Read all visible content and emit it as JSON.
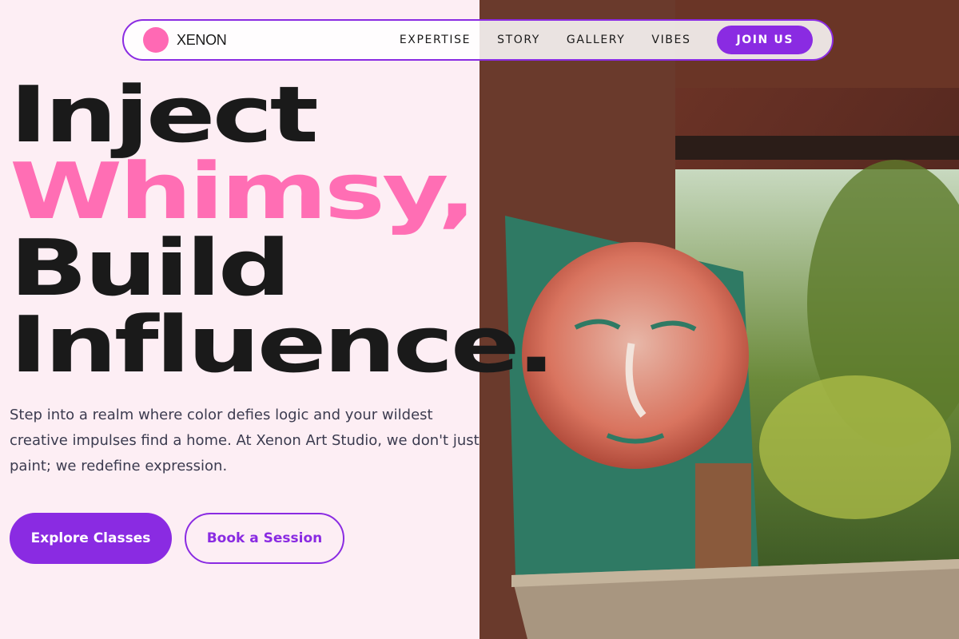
{
  "nav": {
    "brand": "XENON",
    "links": [
      "EXPERTISE",
      "STORY",
      "GALLERY",
      "VIBES"
    ],
    "cta": "JOIN US"
  },
  "hero": {
    "headline_line1": "Inject",
    "headline_line2": "Whimsy,",
    "headline_line3": "Build",
    "headline_line4": "Influence.",
    "intro": "Step into a realm where color defies logic and your wildest creative impulses find a home. At Xenon Art Studio, we don't just paint; we redefine expression.",
    "primary_button": "Explore Classes",
    "secondary_button": "Book a Session"
  },
  "colors": {
    "accent": "#8a2be2",
    "pink": "#ff6eb4",
    "background": "#fdeef4",
    "text": "#1a1a1a"
  },
  "icons": {
    "logo": "pink-circle-logo"
  }
}
